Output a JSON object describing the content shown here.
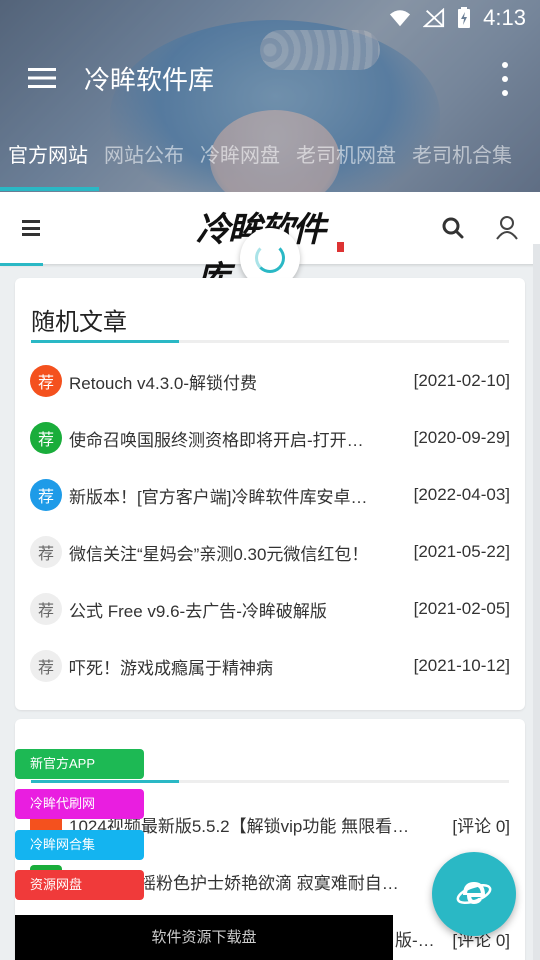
{
  "status_bar": {
    "time": "4:13"
  },
  "toolbar": {
    "title": "冷眸软件库"
  },
  "tabs": [
    {
      "label": "官方网站",
      "active": true
    },
    {
      "label": "网站公布",
      "active": false
    },
    {
      "label": "冷眸网盘",
      "active": false
    },
    {
      "label": "老司机网盘",
      "active": false
    },
    {
      "label": "老司机合集",
      "active": false
    }
  ],
  "site": {
    "logo_text": "冷眸软件库"
  },
  "random_articles": {
    "title": "随机文章",
    "items": [
      {
        "badge": "荐",
        "badge_color": "red",
        "title": "Retouch v4.3.0-解锁付费",
        "date": "[2021-02-10]"
      },
      {
        "badge": "荐",
        "badge_color": "green",
        "title": "使命召唤国服终测资格即将开启-打开…",
        "date": "[2020-09-29]"
      },
      {
        "badge": "荐",
        "badge_color": "blue",
        "title": "新版本！[官方客户端]冷眸软件库安卓…",
        "date": "[2022-04-03]"
      },
      {
        "badge": "荐",
        "badge_color": "gray",
        "title": "微信关注“星妈会”亲测0.30元微信红包！",
        "date": "[2021-05-22]"
      },
      {
        "badge": "荐",
        "badge_color": "gray",
        "title": "公式 Free v9.6-去广告-冷眸破解版",
        "date": "[2021-02-05]"
      },
      {
        "badge": "荐",
        "badge_color": "gray",
        "title": "吓死！游戏成瘾属于精神病",
        "date": "[2021-10-12]"
      }
    ]
  },
  "hot_articles": {
    "items": [
      {
        "title": "1024视频最新版5.5.2【解锁vip功能 無限看…",
        "meta": "[评论 0]"
      },
      {
        "title": "摇粉色护士娇艳欲滴 寂寞难耐自…",
        "meta": ""
      },
      {
        "title": "版-…",
        "meta": "[评论 0]"
      }
    ]
  },
  "float_buttons": [
    {
      "label": "新官方APP",
      "color": "#1db954"
    },
    {
      "label": "冷眸代刷网",
      "color": "#e91ee0"
    },
    {
      "label": "冷眸网合集",
      "color": "#14b4f0"
    },
    {
      "label": "资源网盘",
      "color": "#f03a3a"
    }
  ],
  "bottom_bar": {
    "label": "软件资源下载盘"
  }
}
